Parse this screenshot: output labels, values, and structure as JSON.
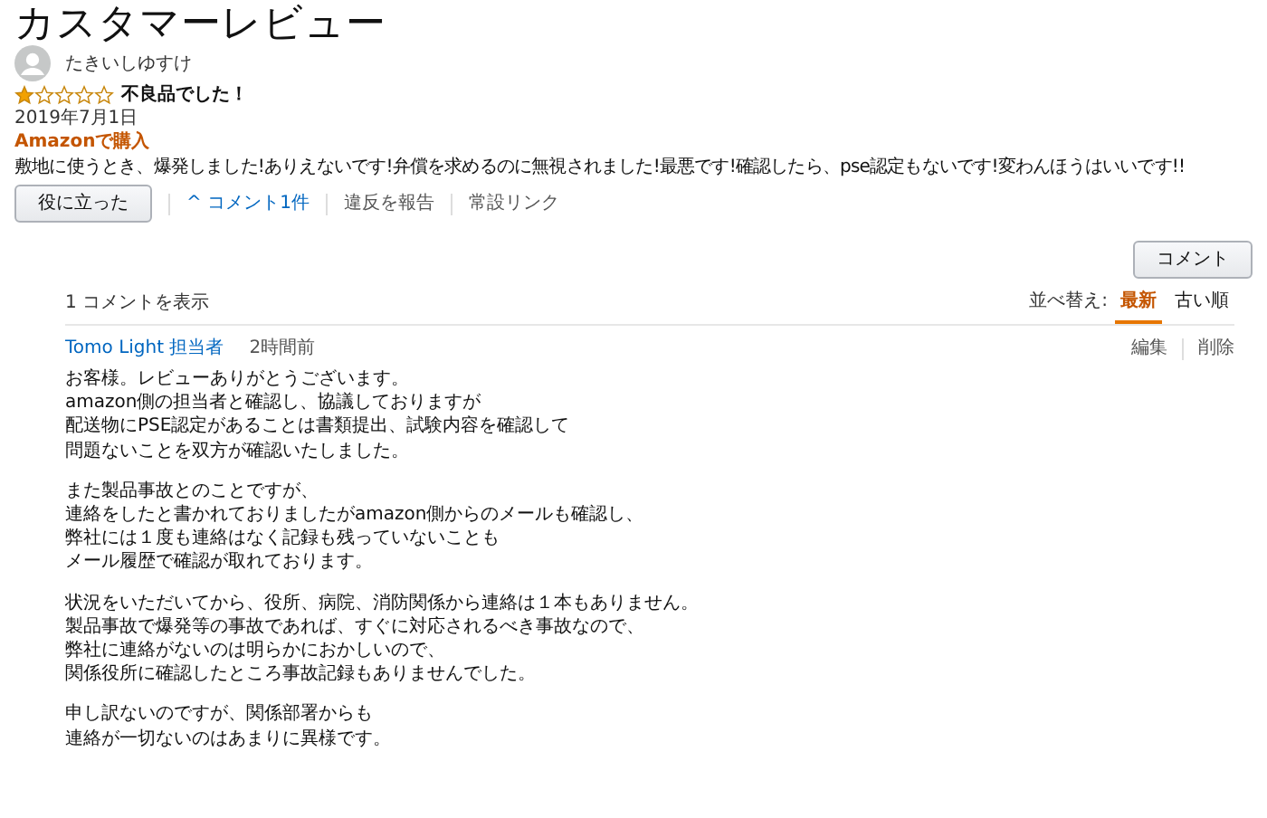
{
  "page_title": "カスタマーレビュー",
  "review": {
    "author": "たきいしゆすけ",
    "stars": 1,
    "headline": "不良品でした！",
    "date": "2019年7月1日",
    "badge": "Amazonで購入",
    "body": "敷地に使うとき、爆発しました!ありえないです!弁償を求めるのに無視されました!最悪です!確認したら、pse認定もないです!変わんほうはいいです!!",
    "helpful_button": "役に立った",
    "comments_toggle": {
      "caret": "^",
      "label": "コメント1件",
      "expanded": true
    },
    "links": [
      "違反を報告",
      "常設リンク"
    ]
  },
  "comment_button": "コメント",
  "comments": {
    "count_label": "1 コメントを表示",
    "sort_label": "並べ替え:",
    "sort_options": [
      {
        "label": "最新",
        "selected": true
      },
      {
        "label": "古い順",
        "selected": false
      }
    ],
    "items": [
      {
        "author": "Tomo Light 担当者",
        "time": "2時間前",
        "actions": [
          "編集",
          "削除"
        ],
        "paragraphs": [
          [
            "お客様。レビューありがとうございます。",
            "amazon側の担当者と確認し、協議しておりますが",
            "配送物にPSE認定があることは書類提出、試験内容を確認して",
            "問題ないことを双方が確認いたしました。"
          ],
          [
            "また製品事故とのことですが、",
            "連絡をしたと書かれておりましたがamazon側からのメールも確認し、",
            "弊社には１度も連絡はなく記録も残っていないことも",
            "メール履歴で確認が取れております。"
          ],
          [
            "状況をいただいてから、役所、病院、消防関係から連絡は１本もありません。",
            "製品事故で爆発等の事故であれば、すぐに対応されるべき事故なので、",
            "弊社に連絡がないのは明らかにおかしいので、",
            "関係役所に確認したところ事故記録もありませんでした。"
          ],
          [
            "申し訳ないのですが、関係部署からも",
            "連絡が一切ないのはあまりに異様です。"
          ]
        ]
      }
    ]
  }
}
